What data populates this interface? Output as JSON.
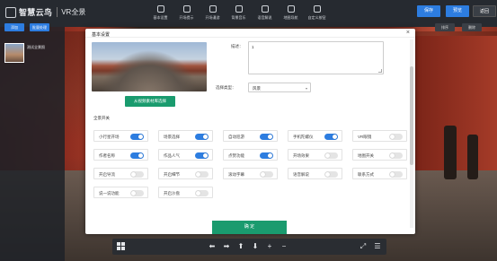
{
  "app": {
    "logo_text": "智慧云鸟",
    "logo_sub": "VR全景"
  },
  "top_nav": [
    {
      "label": "基本设置",
      "icon": "settings-icon"
    },
    {
      "label": "开场提示",
      "icon": "prompt-icon"
    },
    {
      "label": "开场漫游",
      "icon": "tour-icon"
    },
    {
      "label": "背景音乐",
      "icon": "music-icon"
    },
    {
      "label": "语音解说",
      "icon": "voice-icon"
    },
    {
      "label": "地图导航",
      "icon": "map-icon"
    },
    {
      "label": "自定义按钮",
      "icon": "custom-button-icon"
    }
  ],
  "top_buttons": {
    "save": "保存",
    "preview": "预览",
    "back": "返回"
  },
  "left_panel": {
    "btn_add": "添加",
    "btn_batch": "批量处理",
    "scene_label": "测试全景照"
  },
  "bg_buttons": [
    "排序",
    "删除"
  ],
  "modal": {
    "title": "基本设置",
    "close": "×",
    "pick_button": "从视频素材库选择",
    "desc_label": "描述：",
    "desc_value": "1",
    "select_label": "选择类型：",
    "select_value": "风景",
    "select_arrow": "▾",
    "section_title": "全景开关",
    "confirm": "确 定"
  },
  "toggles": [
    {
      "label": "小行星开场",
      "on": true
    },
    {
      "label": "场景选择",
      "on": true
    },
    {
      "label": "自动巡游",
      "on": true
    },
    {
      "label": "手机陀螺仪",
      "on": true
    },
    {
      "label": "VR眼镜",
      "on": false
    },
    {
      "label": "作者名称",
      "on": true
    },
    {
      "label": "作品人气",
      "on": true
    },
    {
      "label": "点赞功能",
      "on": true
    },
    {
      "label": "开场效果",
      "on": false
    },
    {
      "label": "地图开关",
      "on": false
    },
    {
      "label": "开启导流",
      "on": false
    },
    {
      "label": "开启细节",
      "on": false
    },
    {
      "label": "滚动字幕",
      "on": false
    },
    {
      "label": "语音解说",
      "on": false
    },
    {
      "label": "联系方式",
      "on": false
    },
    {
      "label": "说一说功能",
      "on": false
    },
    {
      "label": "开启沙盘",
      "on": false
    }
  ],
  "bottom_bar": {
    "left": "⬅",
    "right": "➡",
    "up": "⬆",
    "down": "⬇",
    "plus": "+",
    "minus": "−",
    "fullscreen": "⤢",
    "menu": "☰"
  }
}
